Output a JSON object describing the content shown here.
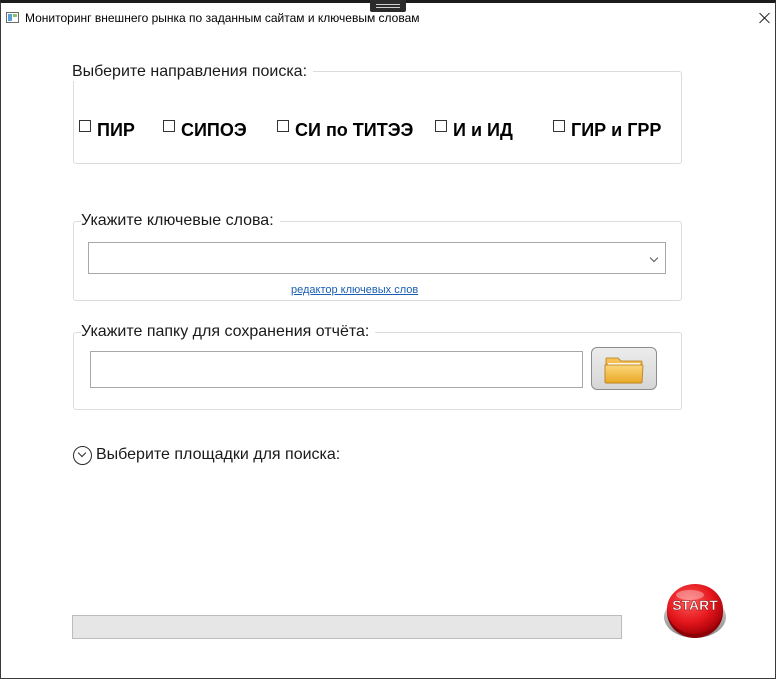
{
  "window": {
    "title": "Мониторинг внешнего рынка по заданным сайтам и ключевым словам"
  },
  "directions": {
    "legend": "Выберите направления поиска:",
    "options": [
      {
        "label": "ПИР",
        "checked": false
      },
      {
        "label": "СИПОЭ",
        "checked": false
      },
      {
        "label": "СИ по ТИТЭЭ",
        "checked": false
      },
      {
        "label": "И и ИД",
        "checked": false
      },
      {
        "label": "ГИР и ГРР",
        "checked": false
      }
    ]
  },
  "keywords": {
    "legend": "Укажите ключевые слова:",
    "selected_value": "",
    "editor_link": "редактор ключевых слов"
  },
  "folder": {
    "legend": "Укажите папку для сохранения отчёта:",
    "path_value": "",
    "browse_icon": "folder-icon"
  },
  "sites": {
    "label": "Выберите площадки для поиска:",
    "expanded": false
  },
  "progress": {
    "value": 0
  },
  "start": {
    "label": "START",
    "color": "#e3161b"
  }
}
